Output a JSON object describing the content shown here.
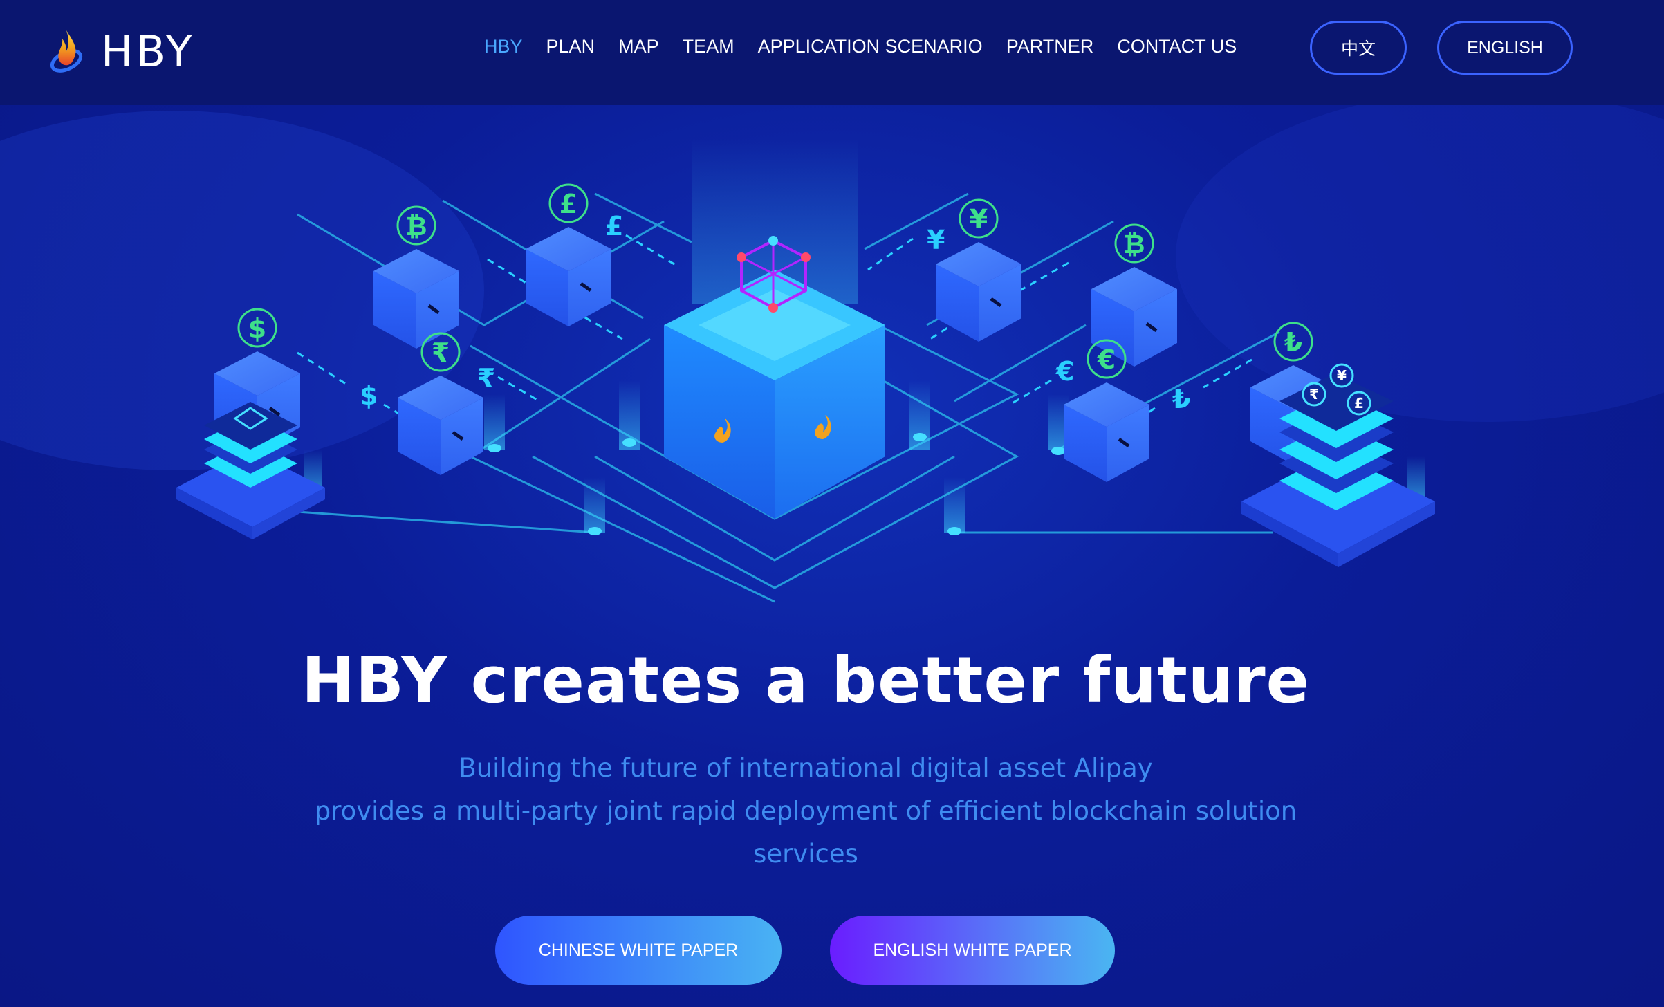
{
  "brand": {
    "name": "HBY",
    "logo_icon": "flame-logo-icon"
  },
  "nav": {
    "items": [
      {
        "label": "HBY",
        "active": true
      },
      {
        "label": "PLAN",
        "active": false
      },
      {
        "label": "MAP",
        "active": false
      },
      {
        "label": "TEAM",
        "active": false
      },
      {
        "label": "APPLICATION SCENARIO",
        "active": false
      },
      {
        "label": "PARTNER",
        "active": false
      },
      {
        "label": "CONTACT US",
        "active": false
      }
    ]
  },
  "language": {
    "chinese_label": "中文",
    "english_label": "ENGLISH"
  },
  "illustration": {
    "currency_symbols": [
      "₿",
      "£",
      "$",
      "₹",
      "¥",
      "₿",
      "€",
      "₺"
    ],
    "arrow_symbols": [
      "£",
      "₿",
      "$",
      "₹",
      "¥",
      "₿",
      "€",
      "₺"
    ],
    "stack_coin_symbols": [
      "₹",
      "¥",
      "£",
      "$",
      "₿"
    ]
  },
  "hero": {
    "title": "HBY creates a better future",
    "subtitle_line1": "Building the future of international digital asset Alipay",
    "subtitle_line2": "provides a multi-party joint rapid deployment of efficient blockchain solution",
    "subtitle_line3": "services"
  },
  "buttons": {
    "chinese_white_paper": "CHINESE WHITE PAPER",
    "english_white_paper": "ENGLISH WHITE PAPER"
  },
  "colors": {
    "background": "#0b1d98",
    "header": "#0a1670",
    "nav_active": "#4aa8ff",
    "accent_green": "#3ee08a",
    "subtitle": "#3f8cf0",
    "button_border": "#3b63ff"
  }
}
